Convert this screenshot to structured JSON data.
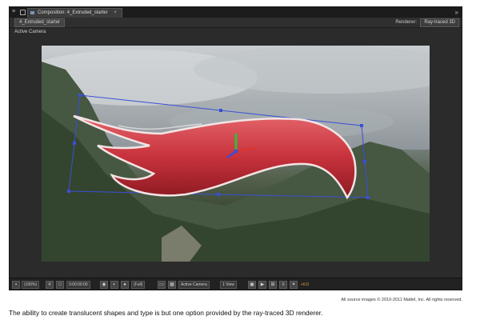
{
  "panel": {
    "tab_label": "Composition: 4_Extruded_starter",
    "tab_close": "×",
    "menu_glyph": "≡",
    "flyout_glyph": "»"
  },
  "subheader": {
    "breadcrumb": "4_Extruded_starter",
    "renderer_label": "Renderer:",
    "renderer_value": "Ray-traced 3D"
  },
  "viewer": {
    "view_label": "Active Camera"
  },
  "toolbar": {
    "magnification": "(100%)",
    "timecode": "0:00:00:00",
    "resolution": "(Full)",
    "view": "Active Camera",
    "view_layout": "1 View",
    "exposure": "+0.0",
    "icons": [
      "render-quality-icon",
      "grid-icon",
      "camera-snapshot-icon",
      "show-snapshot-icon",
      "color-channel-icon",
      "region-icon",
      "transparency-grid-icon",
      "layout-icon",
      "fast-preview-icon",
      "flowchart-icon",
      "exposure-icon"
    ]
  },
  "colors": {
    "shape_red": "#c8323c",
    "handle_blue": "#3a4fd6",
    "exposure": "#e6a93a"
  },
  "credits": "All source images © 2010-2011 Mattel, Inc. All rights reserved.",
  "caption": "The ability to create translucent shapes and type is but one option provided by the ray-traced 3D renderer."
}
